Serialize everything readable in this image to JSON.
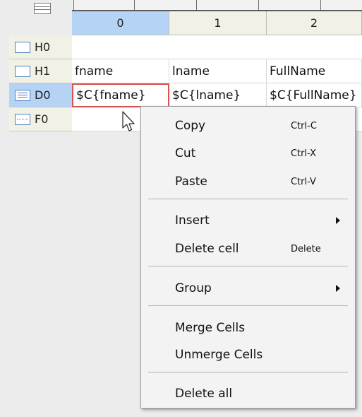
{
  "columns": [
    "0",
    "1",
    "2"
  ],
  "rows": [
    {
      "label": "H0",
      "icon": "row-blank-icon",
      "cells": [
        "",
        "",
        ""
      ]
    },
    {
      "label": "H1",
      "icon": "row-blank-icon",
      "cells": [
        "fname",
        "lname",
        "FullName"
      ]
    },
    {
      "label": "D0",
      "icon": "row-data-icon",
      "cells": [
        "$C{fname}",
        "$C{lname}",
        "$C{FullName}"
      ]
    },
    {
      "label": "F0",
      "icon": "row-footer-icon",
      "cells": [
        "",
        "",
        ""
      ]
    }
  ],
  "menu": {
    "copy": {
      "label": "Copy",
      "shortcut": "Ctrl-C"
    },
    "cut": {
      "label": "Cut",
      "shortcut": "Ctrl-X"
    },
    "paste": {
      "label": "Paste",
      "shortcut": "Ctrl-V"
    },
    "insert": {
      "label": "Insert"
    },
    "delete_cell": {
      "label": "Delete cell",
      "shortcut": "Delete"
    },
    "group": {
      "label": "Group"
    },
    "merge": {
      "label": "Merge Cells"
    },
    "unmerge": {
      "label": "Unmerge Cells"
    },
    "delete_all": {
      "label": "Delete all"
    }
  },
  "colors": {
    "selected_header": "#b5d3f4",
    "active_cell_border": "#d9534f"
  }
}
